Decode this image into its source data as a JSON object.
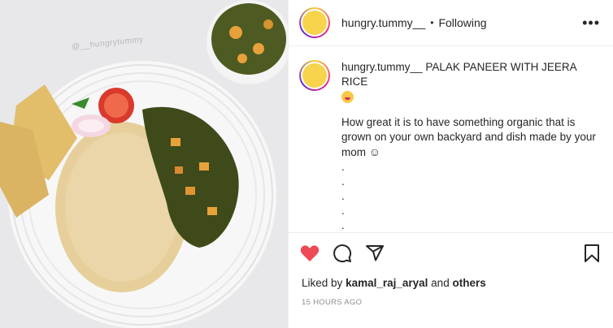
{
  "media": {
    "watermark": "@__hungrytummy"
  },
  "header": {
    "username": "hungry.tummy__",
    "separator": "•",
    "follow_state": "Following",
    "more_label": "•••"
  },
  "caption": {
    "username": "hungry.tummy__",
    "title": "PALAK PANEER WITH JEERA RICE",
    "text": "How great it is to have something organic that is grown on your own backyard and dish made by your mom",
    "smile": "☺",
    "dots": [
      ".",
      ".",
      ".",
      ".",
      "."
    ]
  },
  "actions": {
    "icons": [
      "heart-icon",
      "comment-icon",
      "share-icon",
      "bookmark-icon"
    ],
    "heart_color": "#ed4956"
  },
  "likes": {
    "prefix": "Liked by",
    "user": "kamal_raj_aryal",
    "conjunction": "and",
    "others": "others"
  },
  "timestamp": "15 HOURS AGO"
}
